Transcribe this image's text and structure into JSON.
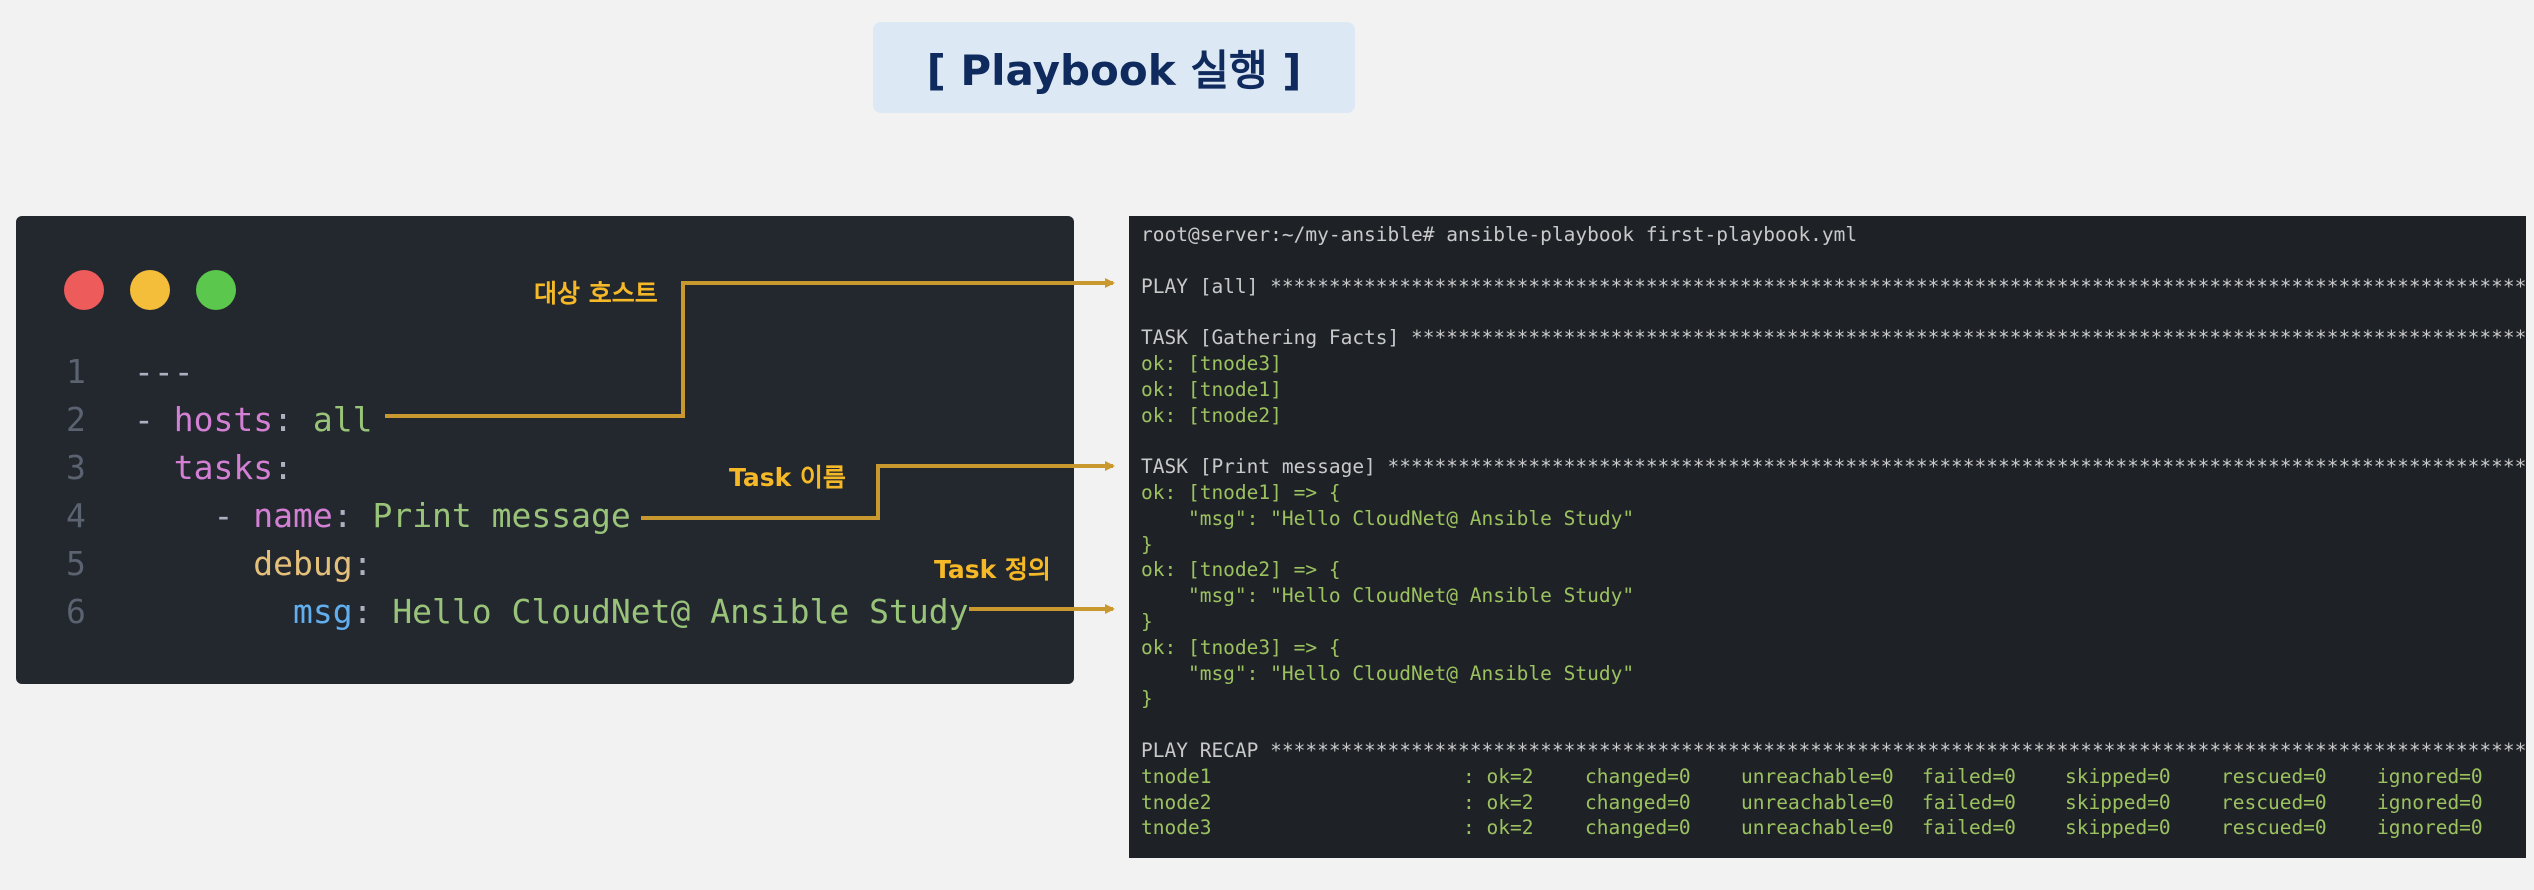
{
  "title": "[ Playbook 실행 ]",
  "colors": {
    "accent": "#c9982f",
    "title": "#0f2a5c",
    "ok": "#9cc25f",
    "callout": "#f5b927"
  },
  "editor": {
    "window_buttons": [
      "close-dot",
      "minimize-dot",
      "maximize-dot"
    ],
    "lines": [
      {
        "num": "1",
        "tokens": [
          {
            "t": "---",
            "c": "gray"
          }
        ]
      },
      {
        "num": "2",
        "tokens": [
          {
            "t": "- ",
            "c": "gray"
          },
          {
            "t": "hosts",
            "c": "pink"
          },
          {
            "t": ": ",
            "c": "gray"
          },
          {
            "t": "all",
            "c": "green"
          }
        ]
      },
      {
        "num": "3",
        "tokens": [
          {
            "t": "  ",
            "c": "gray"
          },
          {
            "t": "tasks",
            "c": "pink"
          },
          {
            "t": ":",
            "c": "gray"
          }
        ]
      },
      {
        "num": "4",
        "tokens": [
          {
            "t": "    - ",
            "c": "gray"
          },
          {
            "t": "name",
            "c": "pink"
          },
          {
            "t": ": ",
            "c": "gray"
          },
          {
            "t": "Print message",
            "c": "green"
          }
        ]
      },
      {
        "num": "5",
        "tokens": [
          {
            "t": "      ",
            "c": "gray"
          },
          {
            "t": "debug",
            "c": "yellow"
          },
          {
            "t": ":",
            "c": "gray"
          }
        ]
      },
      {
        "num": "6",
        "tokens": [
          {
            "t": "        ",
            "c": "gray"
          },
          {
            "t": "msg",
            "c": "blue"
          },
          {
            "t": ": ",
            "c": "gray"
          },
          {
            "t": "Hello CloudNet@ Ansible Study",
            "c": "green"
          }
        ]
      }
    ]
  },
  "callouts": {
    "target_host": "대상 호스트",
    "task_name": "Task 이름",
    "task_def": "Task 정의"
  },
  "terminal": {
    "lines": [
      {
        "text": "root@server:~/my-ansible# ansible-playbook first-playbook.yml",
        "style": "w"
      },
      {
        "text": "",
        "style": "w"
      },
      {
        "text": "PLAY [all] *******************************************************************************************************************",
        "style": "w"
      },
      {
        "text": "",
        "style": "w"
      },
      {
        "text": "TASK [Gathering Facts] *******************************************************************************************************",
        "style": "w"
      },
      {
        "text": "ok: [tnode3]",
        "style": "g"
      },
      {
        "text": "ok: [tnode1]",
        "style": "g"
      },
      {
        "text": "ok: [tnode2]",
        "style": "g"
      },
      {
        "text": "",
        "style": "w"
      },
      {
        "text": "TASK [Print message] *********************************************************************************************************",
        "style": "w"
      },
      {
        "text": "ok: [tnode1] => {",
        "style": "g"
      },
      {
        "text": "    \"msg\": \"Hello CloudNet@ Ansible Study\"",
        "style": "g"
      },
      {
        "text": "}",
        "style": "g"
      },
      {
        "text": "ok: [tnode2] => {",
        "style": "g"
      },
      {
        "text": "    \"msg\": \"Hello CloudNet@ Ansible Study\"",
        "style": "g"
      },
      {
        "text": "}",
        "style": "g"
      },
      {
        "text": "ok: [tnode3] => {",
        "style": "g"
      },
      {
        "text": "    \"msg\": \"Hello CloudNet@ Ansible Study\"",
        "style": "g"
      },
      {
        "text": "}",
        "style": "g"
      },
      {
        "text": "",
        "style": "w"
      },
      {
        "text": "PLAY RECAP *******************************************************************************************************************",
        "style": "w"
      }
    ],
    "recap": [
      [
        "tnode1",
        ": ok=2",
        "changed=0",
        "unreachable=0",
        "failed=0",
        "skipped=0",
        "rescued=0",
        "ignored=0"
      ],
      [
        "tnode2",
        ": ok=2",
        "changed=0",
        "unreachable=0",
        "failed=0",
        "skipped=0",
        "rescued=0",
        "ignored=0"
      ],
      [
        "tnode3",
        ": ok=2",
        "changed=0",
        "unreachable=0",
        "failed=0",
        "skipped=0",
        "rescued=0",
        "ignored=0"
      ]
    ]
  }
}
